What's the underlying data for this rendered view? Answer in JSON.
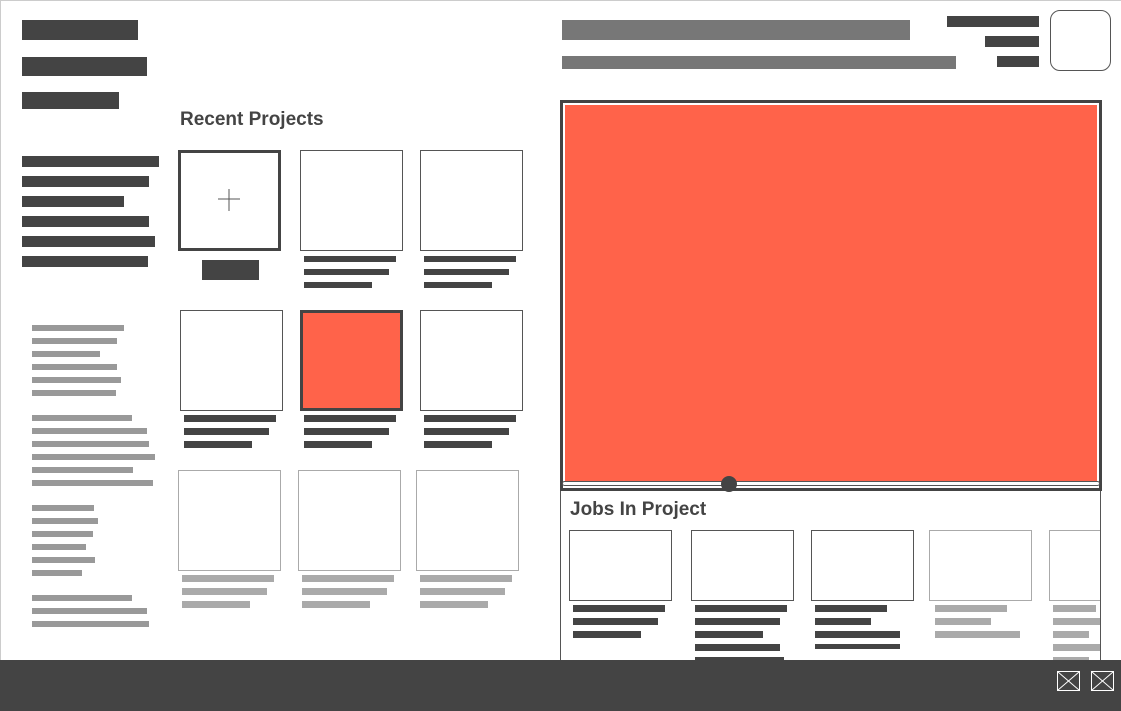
{
  "recent_projects": {
    "title": "Recent Projects"
  },
  "jobs_in_project": {
    "title": "Jobs In Project"
  },
  "icons": {
    "new_project": "plus-icon",
    "account": "avatar-placeholder",
    "bottom_1": "image-placeholder-icon",
    "bottom_2": "image-placeholder-icon"
  },
  "colors": {
    "accent": "#ff634a",
    "dark": "#444444",
    "medium": "#777777",
    "light": "#999999",
    "background": "#ffffff"
  },
  "preview": {
    "scrub_progress": 0.31
  }
}
